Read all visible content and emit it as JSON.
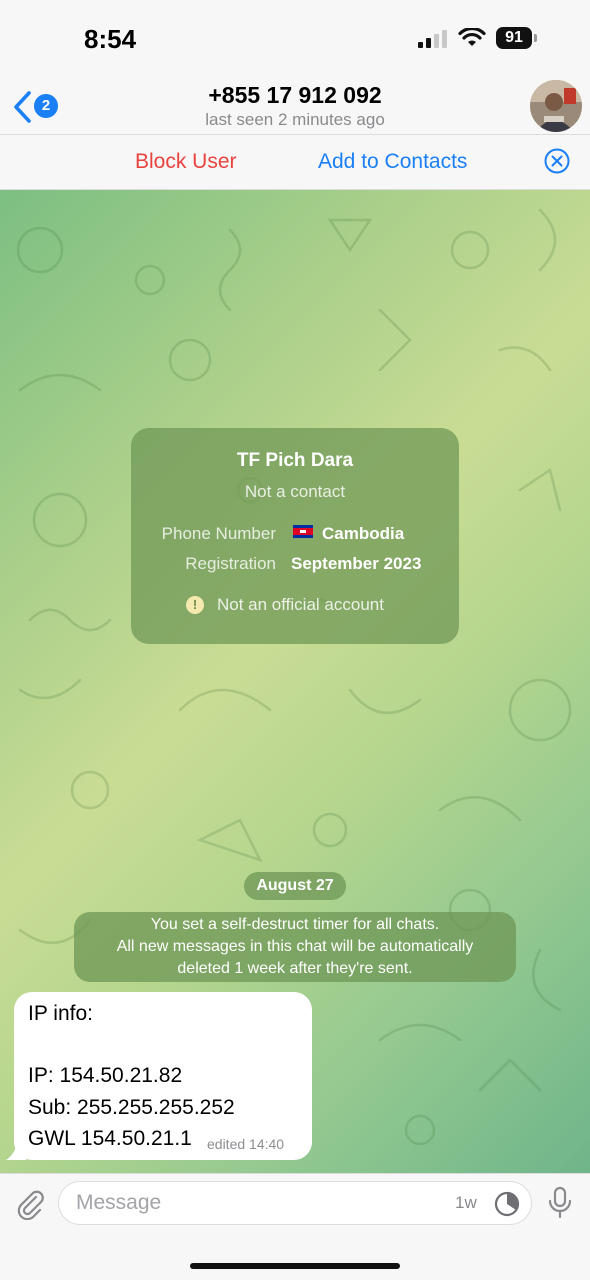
{
  "status": {
    "time": "8:54",
    "battery": "91"
  },
  "nav": {
    "back_badge": "2",
    "title": "+855 17 912 092",
    "subtitle": "last seen 2 minutes ago"
  },
  "actions": {
    "block": "Block User",
    "add": "Add to Contacts"
  },
  "info_card": {
    "name": "TF Pich Dara",
    "status": "Not a contact",
    "phone_label": "Phone Number",
    "phone_value": "Cambodia",
    "reg_label": "Registration",
    "reg_value": "September 2023",
    "warning": "Not an official account"
  },
  "date_pill": "August 27",
  "service_lines": [
    "You set a self-destruct timer for all chats.",
    "All new messages in this chat will be automatically",
    "deleted 1 week after they're sent."
  ],
  "message": {
    "lines": [
      "IP info:",
      "",
      "IP: 154.50.21.82",
      "Sub: 255.255.255.252",
      "GWL 154.50.21.1"
    ],
    "meta": "edited 14:40"
  },
  "input": {
    "placeholder": "Message",
    "timer": "1w"
  },
  "colors": {
    "accent": "#1b7ff5",
    "danger": "#e8433e",
    "chat_green": "#a9cf8a"
  }
}
